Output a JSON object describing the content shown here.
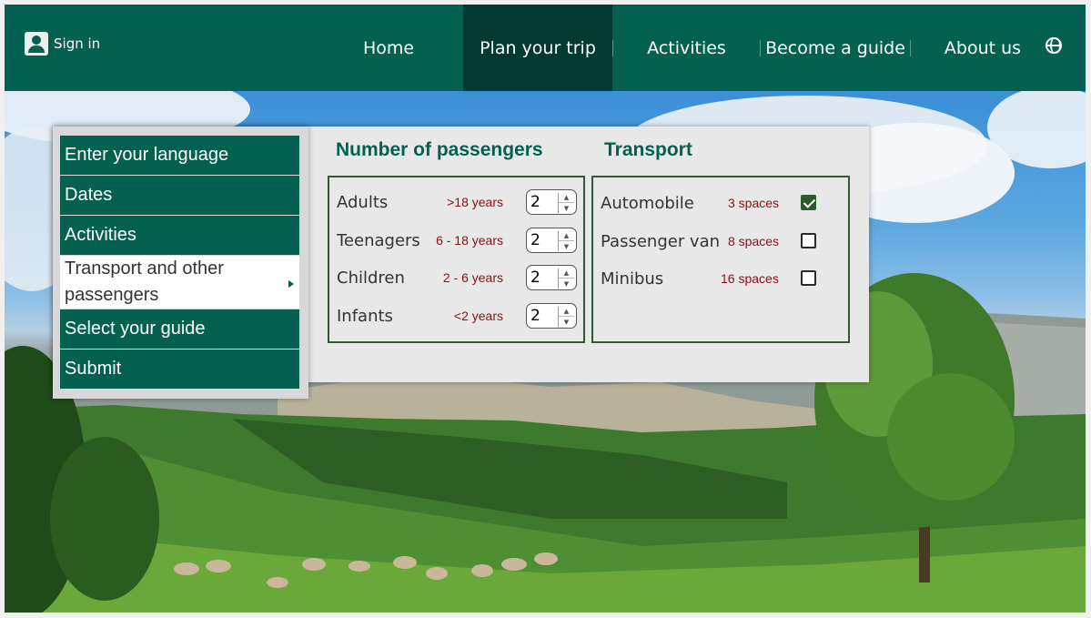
{
  "header": {
    "signin_label": "Sign in",
    "nav": [
      {
        "label": "Home",
        "active": false
      },
      {
        "label": "Plan your trip",
        "active": true
      },
      {
        "label": "Activities",
        "active": false
      },
      {
        "label": "Become a guide",
        "active": false
      },
      {
        "label": "About us",
        "active": false
      }
    ],
    "globe_icon": "globe-icon",
    "colors": {
      "brand": "#04604f",
      "active": "#023a31"
    }
  },
  "steps": [
    {
      "label": "Enter your language",
      "active": false
    },
    {
      "label": "Dates",
      "active": false
    },
    {
      "label": "Activities",
      "active": false
    },
    {
      "label": "Transport and other passengers",
      "active": true
    },
    {
      "label": "Select your guide",
      "active": false
    },
    {
      "label": "Submit",
      "active": false
    }
  ],
  "passengers": {
    "title": "Number of passengers",
    "rows": [
      {
        "label": "Adults",
        "age": ">18 years",
        "value": "2"
      },
      {
        "label": "Teenagers",
        "age": "6 - 18 years",
        "value": "2"
      },
      {
        "label": "Children",
        "age": "2 - 6 years",
        "value": "2"
      },
      {
        "label": "Infants",
        "age": "<2 years",
        "value": "2"
      }
    ]
  },
  "transport": {
    "title": "Transport",
    "options": [
      {
        "label": "Automobile",
        "capacity": "3 spaces",
        "checked": true
      },
      {
        "label": "Passenger van",
        "capacity": "8 spaces",
        "checked": false
      },
      {
        "label": "Minibus",
        "capacity": "16 spaces",
        "checked": false
      }
    ]
  }
}
